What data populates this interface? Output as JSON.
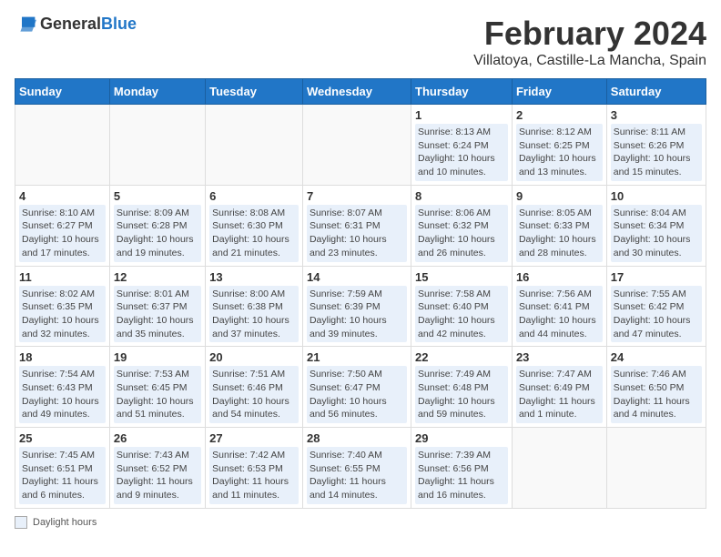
{
  "header": {
    "logo_general": "General",
    "logo_blue": "Blue",
    "title": "February 2024",
    "subtitle": "Villatoya, Castille-La Mancha, Spain"
  },
  "days_of_week": [
    "Sunday",
    "Monday",
    "Tuesday",
    "Wednesday",
    "Thursday",
    "Friday",
    "Saturday"
  ],
  "weeks": [
    [
      {
        "day": "",
        "info": ""
      },
      {
        "day": "",
        "info": ""
      },
      {
        "day": "",
        "info": ""
      },
      {
        "day": "",
        "info": ""
      },
      {
        "day": "1",
        "info": "Sunrise: 8:13 AM\nSunset: 6:24 PM\nDaylight: 10 hours and 10 minutes."
      },
      {
        "day": "2",
        "info": "Sunrise: 8:12 AM\nSunset: 6:25 PM\nDaylight: 10 hours and 13 minutes."
      },
      {
        "day": "3",
        "info": "Sunrise: 8:11 AM\nSunset: 6:26 PM\nDaylight: 10 hours and 15 minutes."
      }
    ],
    [
      {
        "day": "4",
        "info": "Sunrise: 8:10 AM\nSunset: 6:27 PM\nDaylight: 10 hours and 17 minutes."
      },
      {
        "day": "5",
        "info": "Sunrise: 8:09 AM\nSunset: 6:28 PM\nDaylight: 10 hours and 19 minutes."
      },
      {
        "day": "6",
        "info": "Sunrise: 8:08 AM\nSunset: 6:30 PM\nDaylight: 10 hours and 21 minutes."
      },
      {
        "day": "7",
        "info": "Sunrise: 8:07 AM\nSunset: 6:31 PM\nDaylight: 10 hours and 23 minutes."
      },
      {
        "day": "8",
        "info": "Sunrise: 8:06 AM\nSunset: 6:32 PM\nDaylight: 10 hours and 26 minutes."
      },
      {
        "day": "9",
        "info": "Sunrise: 8:05 AM\nSunset: 6:33 PM\nDaylight: 10 hours and 28 minutes."
      },
      {
        "day": "10",
        "info": "Sunrise: 8:04 AM\nSunset: 6:34 PM\nDaylight: 10 hours and 30 minutes."
      }
    ],
    [
      {
        "day": "11",
        "info": "Sunrise: 8:02 AM\nSunset: 6:35 PM\nDaylight: 10 hours and 32 minutes."
      },
      {
        "day": "12",
        "info": "Sunrise: 8:01 AM\nSunset: 6:37 PM\nDaylight: 10 hours and 35 minutes."
      },
      {
        "day": "13",
        "info": "Sunrise: 8:00 AM\nSunset: 6:38 PM\nDaylight: 10 hours and 37 minutes."
      },
      {
        "day": "14",
        "info": "Sunrise: 7:59 AM\nSunset: 6:39 PM\nDaylight: 10 hours and 39 minutes."
      },
      {
        "day": "15",
        "info": "Sunrise: 7:58 AM\nSunset: 6:40 PM\nDaylight: 10 hours and 42 minutes."
      },
      {
        "day": "16",
        "info": "Sunrise: 7:56 AM\nSunset: 6:41 PM\nDaylight: 10 hours and 44 minutes."
      },
      {
        "day": "17",
        "info": "Sunrise: 7:55 AM\nSunset: 6:42 PM\nDaylight: 10 hours and 47 minutes."
      }
    ],
    [
      {
        "day": "18",
        "info": "Sunrise: 7:54 AM\nSunset: 6:43 PM\nDaylight: 10 hours and 49 minutes."
      },
      {
        "day": "19",
        "info": "Sunrise: 7:53 AM\nSunset: 6:45 PM\nDaylight: 10 hours and 51 minutes."
      },
      {
        "day": "20",
        "info": "Sunrise: 7:51 AM\nSunset: 6:46 PM\nDaylight: 10 hours and 54 minutes."
      },
      {
        "day": "21",
        "info": "Sunrise: 7:50 AM\nSunset: 6:47 PM\nDaylight: 10 hours and 56 minutes."
      },
      {
        "day": "22",
        "info": "Sunrise: 7:49 AM\nSunset: 6:48 PM\nDaylight: 10 hours and 59 minutes."
      },
      {
        "day": "23",
        "info": "Sunrise: 7:47 AM\nSunset: 6:49 PM\nDaylight: 11 hours and 1 minute."
      },
      {
        "day": "24",
        "info": "Sunrise: 7:46 AM\nSunset: 6:50 PM\nDaylight: 11 hours and 4 minutes."
      }
    ],
    [
      {
        "day": "25",
        "info": "Sunrise: 7:45 AM\nSunset: 6:51 PM\nDaylight: 11 hours and 6 minutes."
      },
      {
        "day": "26",
        "info": "Sunrise: 7:43 AM\nSunset: 6:52 PM\nDaylight: 11 hours and 9 minutes."
      },
      {
        "day": "27",
        "info": "Sunrise: 7:42 AM\nSunset: 6:53 PM\nDaylight: 11 hours and 11 minutes."
      },
      {
        "day": "28",
        "info": "Sunrise: 7:40 AM\nSunset: 6:55 PM\nDaylight: 11 hours and 14 minutes."
      },
      {
        "day": "29",
        "info": "Sunrise: 7:39 AM\nSunset: 6:56 PM\nDaylight: 11 hours and 16 minutes."
      },
      {
        "day": "",
        "info": ""
      },
      {
        "day": "",
        "info": ""
      }
    ]
  ],
  "footer": {
    "box_label": "Daylight hours"
  }
}
